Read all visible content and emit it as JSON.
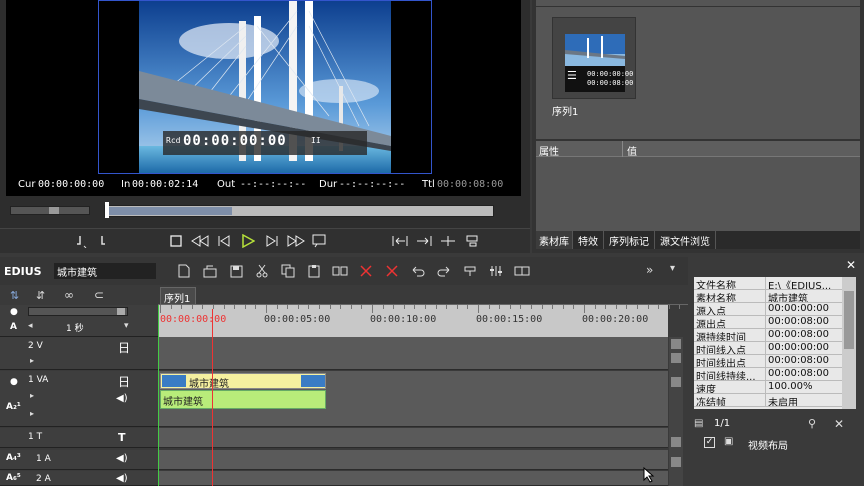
{
  "player": {
    "rec_label": "Rcd",
    "rec_timecode": "00:00:00:00",
    "pause_glyph": "II",
    "cur_label": "Cur",
    "cur_value": "00:00:00:00",
    "in_label": "In",
    "in_value": "00:00:02:14",
    "out_label": "Out",
    "out_value": "--:--:--:--",
    "dur_label": "Dur",
    "dur_value": "--:--:--:--",
    "ttl_label": "Ttl",
    "ttl_value": "00:00:08:00"
  },
  "bin": {
    "clip_name": "序列1",
    "thumb_tc1": "00:00:00:00",
    "thumb_tc2": "00:00:08:00",
    "col_attr": "属性",
    "col_value": "值",
    "tabs": [
      "素材库",
      "特效",
      "序列标记",
      "源文件浏览"
    ]
  },
  "app": {
    "name": "EDIUS",
    "project_name": "城市建筑"
  },
  "timeline": {
    "sequence_tab": "序列1",
    "scale_label": "1 秒",
    "ruler": [
      "00:00:00:00",
      "00:00:05:00",
      "00:00:10:00",
      "00:00:15:00",
      "00:00:20:00"
    ],
    "tracks": [
      {
        "name": "2 V"
      },
      {
        "name": "1 VA"
      },
      {
        "name": "1 T"
      },
      {
        "name": "1 A"
      },
      {
        "name": "2 A"
      }
    ],
    "video_clip_label": "城市建筑",
    "audio_clip_label": "城市建筑"
  },
  "info": {
    "rows": [
      {
        "k": "文件名称",
        "v": "E:\\《EDIUS..."
      },
      {
        "k": "素材名称",
        "v": "城市建筑"
      },
      {
        "k": "源入点",
        "v": "00:00:00:00"
      },
      {
        "k": "源出点",
        "v": "00:00:08:00"
      },
      {
        "k": "源持续时间",
        "v": "00:00:08:00"
      },
      {
        "k": "时间线入点",
        "v": "00:00:00:00"
      },
      {
        "k": "时间线出点",
        "v": "00:00:08:00"
      },
      {
        "k": "时间线持续...",
        "v": "00:00:08:00"
      },
      {
        "k": "速度",
        "v": "100.00%"
      },
      {
        "k": "冻结帧",
        "v": "未启用"
      }
    ],
    "page": "1/1",
    "layout_item": "视频布局"
  }
}
